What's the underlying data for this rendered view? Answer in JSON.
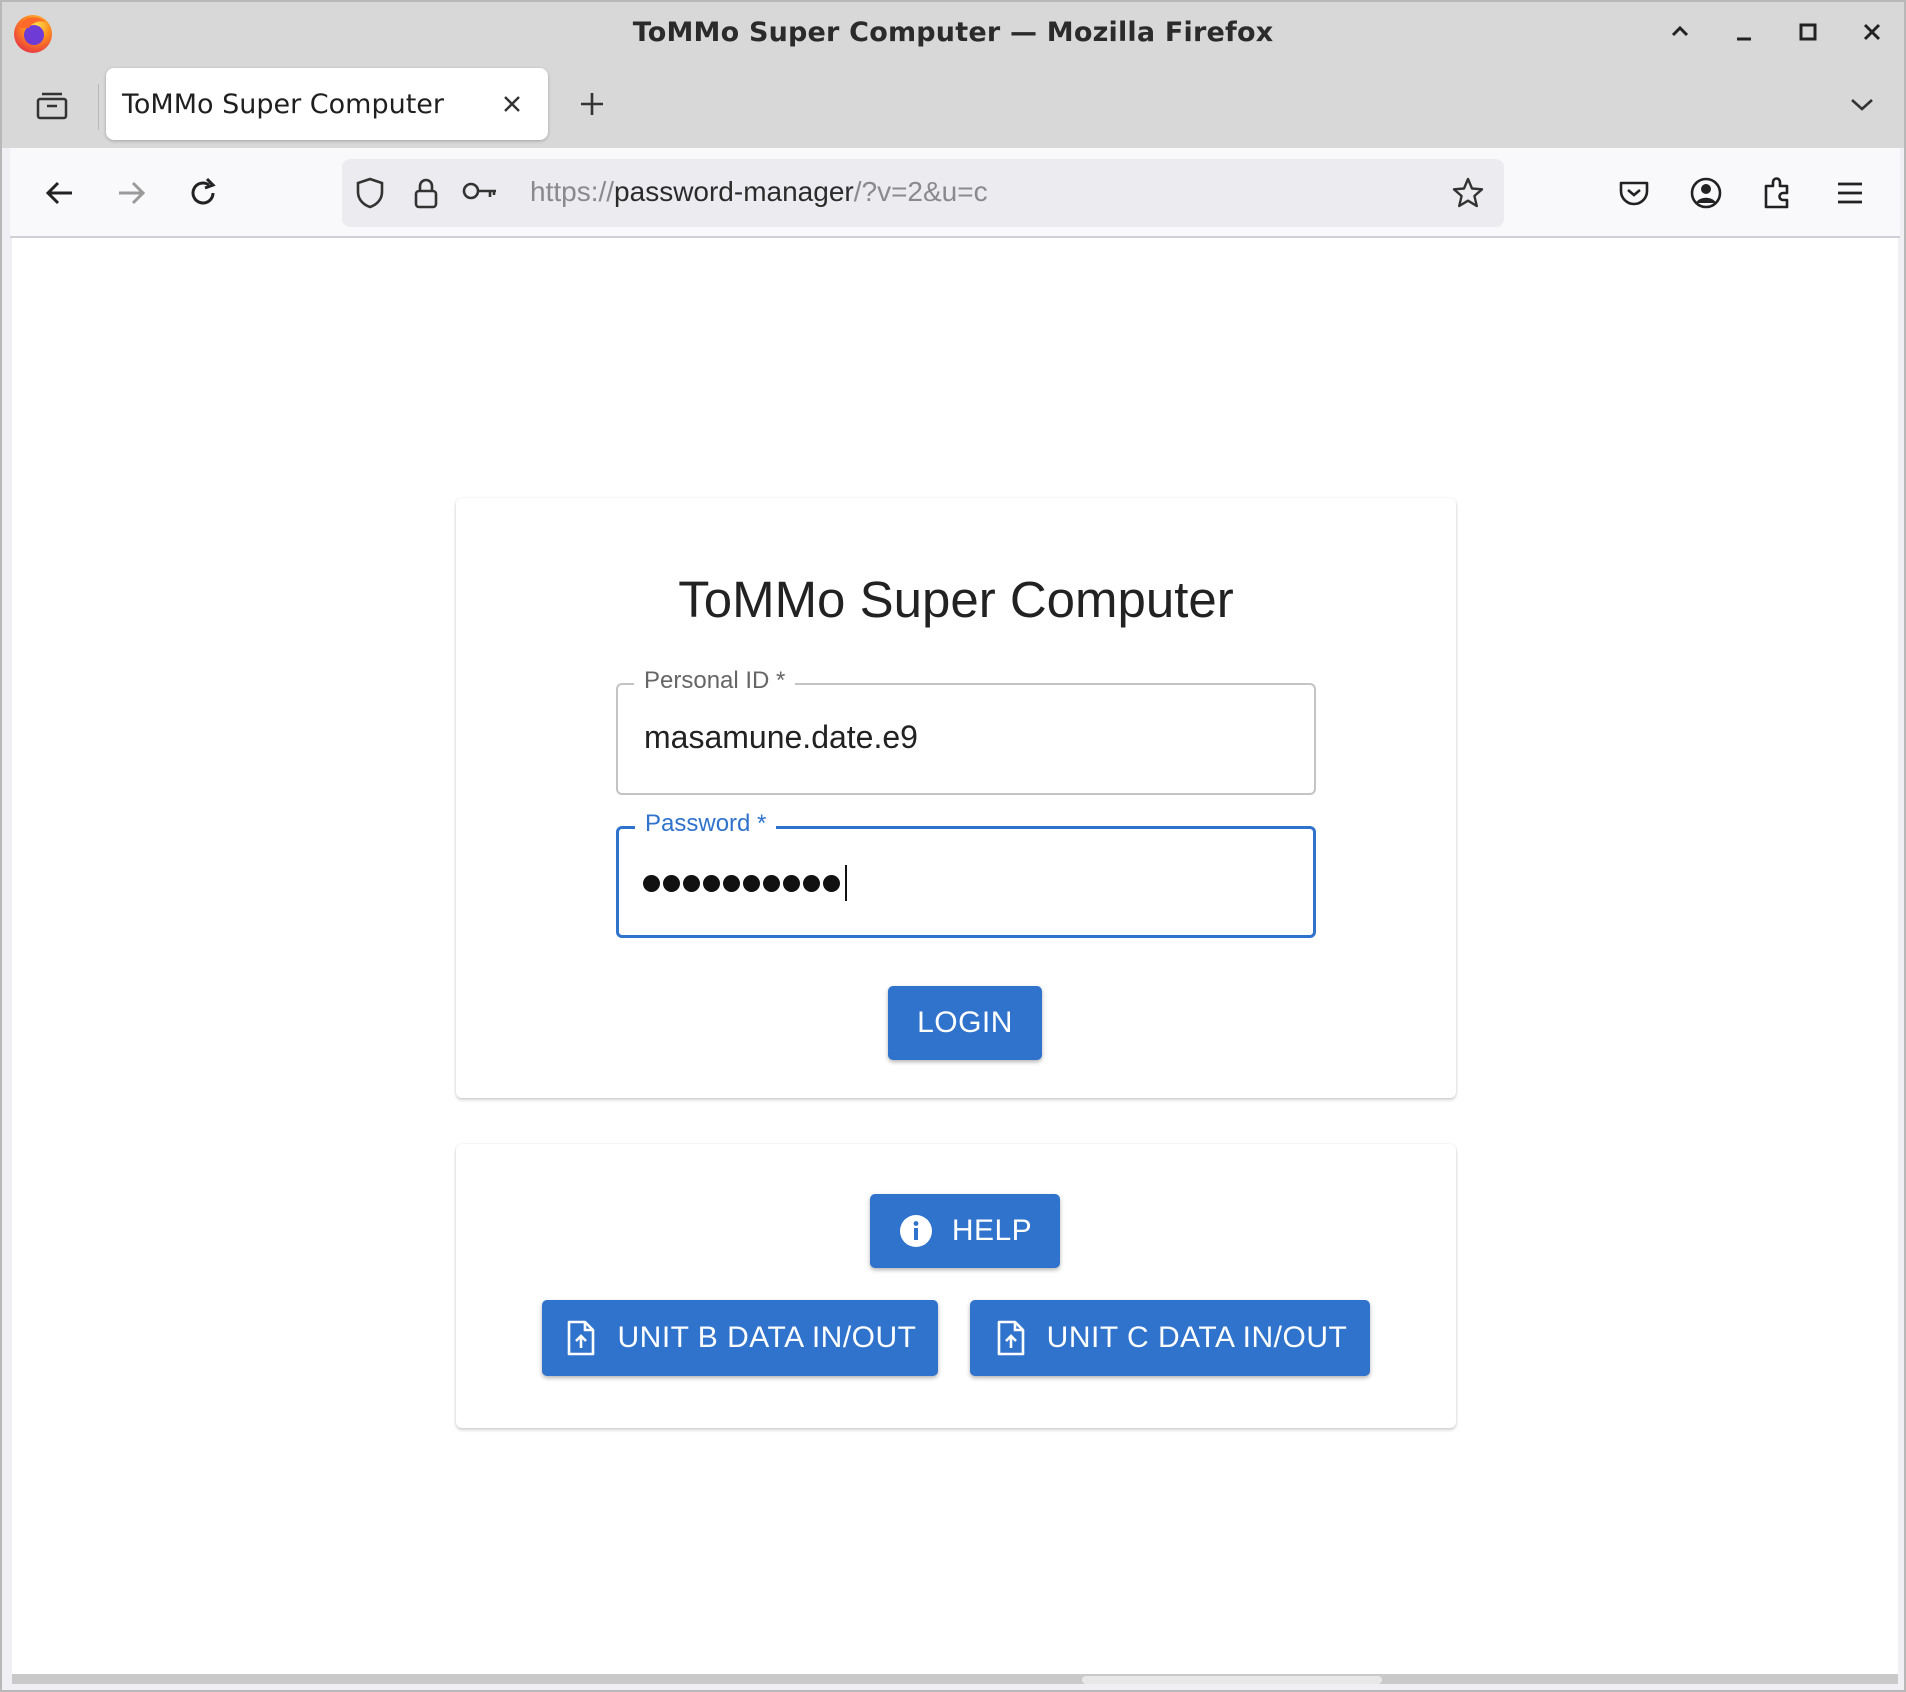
{
  "window": {
    "title": "ToMMo Super Computer — Mozilla Firefox"
  },
  "tabs": [
    {
      "label": "ToMMo Super Computer",
      "active": true
    }
  ],
  "navbar": {
    "url_scheme": "https://",
    "url_host": "password-manager",
    "url_path": "/?v=2&u=c"
  },
  "login": {
    "title": "ToMMo Super Computer",
    "personal_id_label": "Personal ID *",
    "personal_id_value": "masamune.date.e9",
    "password_label": "Password *",
    "password_length": 10,
    "login_button": "LOGIN"
  },
  "links": {
    "help_button": "HELP",
    "unit_b_button": "UNIT B DATA IN/OUT",
    "unit_c_button": "UNIT C DATA IN/OUT"
  },
  "colors": {
    "accent": "#3073cc",
    "page_bg": "#ffffff",
    "chrome_bg": "#d8d8d8"
  },
  "icons": [
    "firefox-logo-icon",
    "minimize-up-icon",
    "minimize-icon",
    "maximize-icon",
    "close-icon",
    "tab-list-icon",
    "tab-close-icon",
    "new-tab-icon",
    "tabs-dropdown-icon",
    "back-icon",
    "forward-icon",
    "reload-icon",
    "shield-icon",
    "lock-icon",
    "key-icon",
    "bookmark-star-icon",
    "pocket-icon",
    "account-icon",
    "extensions-icon",
    "menu-icon",
    "info-icon",
    "file-upload-icon"
  ]
}
